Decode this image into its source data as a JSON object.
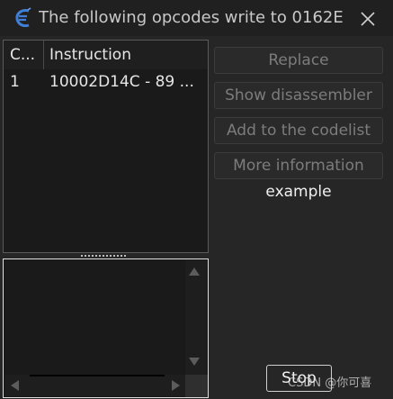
{
  "window": {
    "title": "The following opcodes write to 0162E...",
    "app_icon": "cheat-engine-icon",
    "close_icon": "close-icon"
  },
  "list": {
    "columns": [
      "C...",
      "Instruction"
    ],
    "rows": [
      {
        "count": "1",
        "instruction": "10002D14C - 89 ..."
      }
    ]
  },
  "buttons": {
    "replace": "Replace",
    "show_disassembler": "Show disassembler",
    "add_to_codelist": "Add to the codelist",
    "more_information": "More information",
    "stop": "Stop"
  },
  "example_label": "example",
  "watermark": "CSDN @你可喜",
  "colors": {
    "window_bg": "#262626",
    "panel_bg": "#1a1a1a",
    "disabled_text": "#7c7c7c",
    "text": "#e6e6e6"
  }
}
